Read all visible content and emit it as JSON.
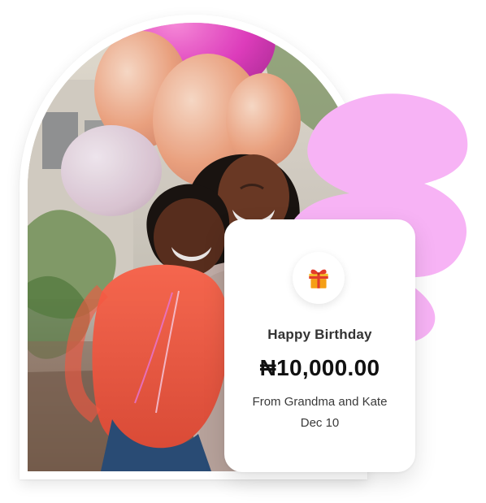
{
  "card": {
    "icon": "gift-icon",
    "title": "Happy Birthday",
    "amount": "₦10,000.00",
    "from": "From Grandma and Kate",
    "date": "Dec 10"
  },
  "colors": {
    "blob": "#F7B3F5",
    "card_bg": "#FFFFFF",
    "title_text": "#333333",
    "amount_text": "#111111"
  },
  "photo": {
    "subject": "photo-two-women-with-balloons"
  }
}
